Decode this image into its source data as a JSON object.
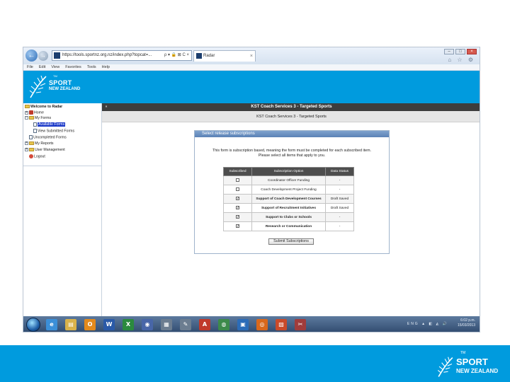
{
  "browser": {
    "url": "https://tools.sportnz.org.nz/index.php?topcat=...",
    "tab_title": "Radar",
    "tab_close": "×",
    "nav_back": "←",
    "nav_forward": "→",
    "url_tools": "ρ ▾ 🔒 ⊠ C ×",
    "window_buttons": [
      "–",
      "□",
      "×"
    ],
    "utility_icons": "⌂ ☆ ⚙",
    "menu": [
      "File",
      "Edit",
      "View",
      "Favorites",
      "Tools",
      "Help"
    ]
  },
  "banner": {
    "logo_line1": "SPORT",
    "logo_line2": "NEW ZEALAND",
    "logo_tm": "TM"
  },
  "sidebar": {
    "items": [
      {
        "label": "Welcome to Radar",
        "icon": "folder-icon",
        "indent": 0
      },
      {
        "label": "Home",
        "icon": "home-icon",
        "indent": 0,
        "expander": "+"
      },
      {
        "label": "My Forms",
        "icon": "folder-icon",
        "indent": 0,
        "expander": "−"
      },
      {
        "label": "Available Forms",
        "icon": "form-icon",
        "indent": 1,
        "selected": true
      },
      {
        "label": "View Submitted Forms",
        "icon": "form-icon",
        "indent": 1
      },
      {
        "label": "Uncompleted Forms",
        "icon": "form-icon",
        "indent": 0
      },
      {
        "label": "My Reports",
        "icon": "folder-icon",
        "indent": 0,
        "expander": "+"
      },
      {
        "label": "User Management",
        "icon": "folder-icon",
        "indent": 0,
        "expander": "+"
      },
      {
        "label": "Logout",
        "icon": "logout-icon",
        "indent": 0
      }
    ]
  },
  "main": {
    "collapse_label": "«",
    "title_bar": "KST Coach Services 3 - Targeted Sports",
    "sub_title": "KST Coach Services 3 - Targeted Sports",
    "panel_title": "Select release subscriptions",
    "intro_line1": "This form is subscription based, meaning the form must be completed for each subscribed item.",
    "intro_line2": "Please select all items that apply to you.",
    "table": {
      "headers": [
        "Subscribed",
        "Subscription Option",
        "Data Status"
      ],
      "rows": [
        {
          "checked": false,
          "option": "Coordinator Officer Funding",
          "status": "-"
        },
        {
          "checked": false,
          "option": "Coach Development Project Funding",
          "status": "-"
        },
        {
          "checked": true,
          "option": "Support of Coach Development Courses",
          "status": "Draft Saved"
        },
        {
          "checked": true,
          "option": "Support of Recruitment Initiatives",
          "status": "Draft Saved"
        },
        {
          "checked": true,
          "option": "Support to Clubs or Schools",
          "status": "-"
        },
        {
          "checked": true,
          "option": "Research or Communication",
          "status": "-"
        }
      ]
    },
    "submit_label": "Submit Subscriptions"
  },
  "taskbar": {
    "icons": [
      {
        "name": "ie-icon",
        "glyph": "e",
        "color": "#3b8fd8"
      },
      {
        "name": "explorer-icon",
        "glyph": "▤",
        "color": "#d9b24a"
      },
      {
        "name": "outlook-icon",
        "glyph": "O",
        "color": "#e38a1c"
      },
      {
        "name": "word-icon",
        "glyph": "W",
        "color": "#2a5aa8"
      },
      {
        "name": "excel-icon",
        "glyph": "X",
        "color": "#2b8a3e"
      },
      {
        "name": "app-globe-icon",
        "glyph": "◉",
        "color": "#4866a8"
      },
      {
        "name": "notepad-icon",
        "glyph": "▦",
        "color": "#6c7d90"
      },
      {
        "name": "app-edit-icon",
        "glyph": "✎",
        "color": "#6c7d90"
      },
      {
        "name": "acrobat-icon",
        "glyph": "A",
        "color": "#c0392b"
      },
      {
        "name": "maps-icon",
        "glyph": "◍",
        "color": "#3c8a4a"
      },
      {
        "name": "app-blue-icon",
        "glyph": "▣",
        "color": "#2b6cb8"
      },
      {
        "name": "firefox-icon",
        "glyph": "◎",
        "color": "#d9681c"
      },
      {
        "name": "pdf-icon",
        "glyph": "▧",
        "color": "#c94a2a"
      },
      {
        "name": "snipping-icon",
        "glyph": "✂",
        "color": "#a03c3c"
      }
    ],
    "tray_text": "ENG ▲ ◧ ◭ 🔊",
    "time": "6:02 p.m.",
    "date": "15/03/2013"
  },
  "footer": {
    "logo_line1": "SPORT",
    "logo_line2": "NEW ZEALAND",
    "logo_tm": "TM"
  }
}
